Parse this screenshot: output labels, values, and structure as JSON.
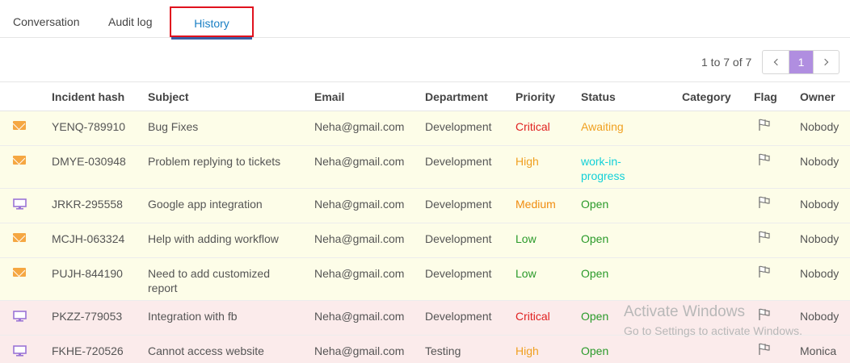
{
  "tabs": {
    "conversation": "Conversation",
    "audit_log": "Audit log",
    "history": "History",
    "active": "History"
  },
  "pagination": {
    "info": "1 to 7 of 7",
    "current_page": "1"
  },
  "table": {
    "headers": {
      "incident_hash": "Incident hash",
      "subject": "Subject",
      "email": "Email",
      "department": "Department",
      "priority": "Priority",
      "status": "Status",
      "category": "Category",
      "flag": "Flag",
      "owner": "Owner"
    },
    "rows": [
      {
        "channel": "mail-icon",
        "hash": "YENQ-789910",
        "subject": "Bug Fixes",
        "email": "Neha@gmail.com",
        "department": "Development",
        "priority": "Critical",
        "status": "Awaiting",
        "category": "",
        "owner": "Nobody",
        "highlight": "yellow"
      },
      {
        "channel": "mail-icon",
        "hash": "DMYE-030948",
        "subject": "Problem replying to tickets",
        "email": "Neha@gmail.com",
        "department": "Development",
        "priority": "High",
        "status": "work-in-progress",
        "category": "",
        "owner": "Nobody",
        "highlight": "yellow"
      },
      {
        "channel": "monitor-icon",
        "hash": "JRKR-295558",
        "subject": "Google app integration",
        "email": "Neha@gmail.com",
        "department": "Development",
        "priority": "Medium",
        "status": "Open",
        "category": "",
        "owner": "Nobody",
        "highlight": "yellow"
      },
      {
        "channel": "mail-icon",
        "hash": "MCJH-063324",
        "subject": "Help with adding workflow",
        "email": "Neha@gmail.com",
        "department": "Development",
        "priority": "Low",
        "status": "Open",
        "category": "",
        "owner": "Nobody",
        "highlight": "yellow"
      },
      {
        "channel": "mail-icon",
        "hash": "PUJH-844190",
        "subject": "Need to add customized report",
        "email": "Neha@gmail.com",
        "department": "Development",
        "priority": "Low",
        "status": "Open",
        "category": "",
        "owner": "Nobody",
        "highlight": "yellow"
      },
      {
        "channel": "monitor-icon",
        "hash": "PKZZ-779053",
        "subject": "Integration with fb",
        "email": "Neha@gmail.com",
        "department": "Development",
        "priority": "Critical",
        "status": "Open",
        "category": "",
        "owner": "Nobody",
        "highlight": "pink"
      },
      {
        "channel": "monitor-icon",
        "hash": "FKHE-720526",
        "subject": "Cannot access website",
        "email": "Neha@gmail.com",
        "department": "Testing",
        "priority": "High",
        "status": "Open",
        "category": "",
        "owner": "Monica",
        "highlight": "pink"
      }
    ]
  },
  "watermark": {
    "line1": "Activate Windows",
    "line2": "Go to Settings to activate Windows."
  },
  "colors": {
    "accent": "#b08ee0",
    "tab_active_text": "#1a7fc4",
    "tab_outline": "#e0121e",
    "critical": "#e02020",
    "high": "#f0a020",
    "open": "#2a9a2a",
    "wip": "#12d0d8",
    "row_yellow": "#fdfde8",
    "row_pink": "#fbebeb"
  }
}
